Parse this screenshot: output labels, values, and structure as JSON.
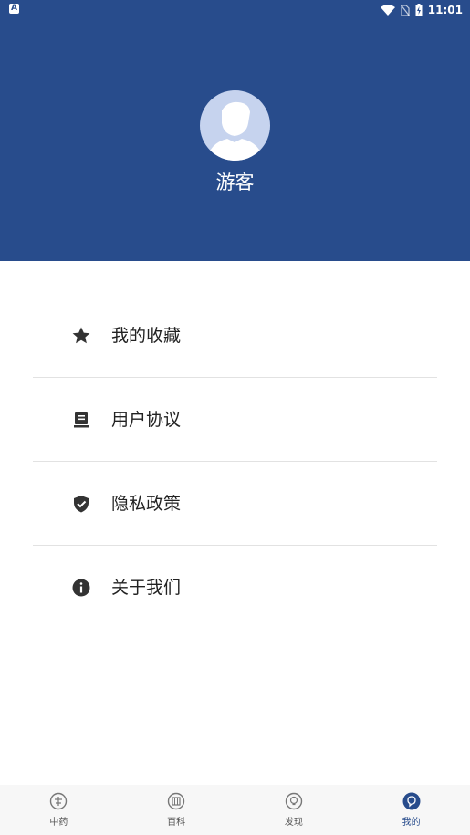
{
  "status_bar": {
    "left_icon": "A",
    "time": "11:01"
  },
  "profile": {
    "username": "游客"
  },
  "menu": {
    "items": [
      {
        "label": "我的收藏",
        "icon": "star-icon"
      },
      {
        "label": "用户协议",
        "icon": "agreement-icon"
      },
      {
        "label": "隐私政策",
        "icon": "shield-check-icon"
      },
      {
        "label": "关于我们",
        "icon": "info-icon"
      }
    ]
  },
  "tabbar": {
    "tabs": [
      {
        "label": "中药",
        "icon": "herb-icon",
        "active": false
      },
      {
        "label": "百科",
        "icon": "encyclopedia-icon",
        "active": false
      },
      {
        "label": "发现",
        "icon": "discover-icon",
        "active": false
      },
      {
        "label": "我的",
        "icon": "profile-icon",
        "active": true
      }
    ]
  },
  "colors": {
    "header": "#284c8c",
    "avatar_bg": "#c6d3ee",
    "active_tab": "#284c8c"
  }
}
